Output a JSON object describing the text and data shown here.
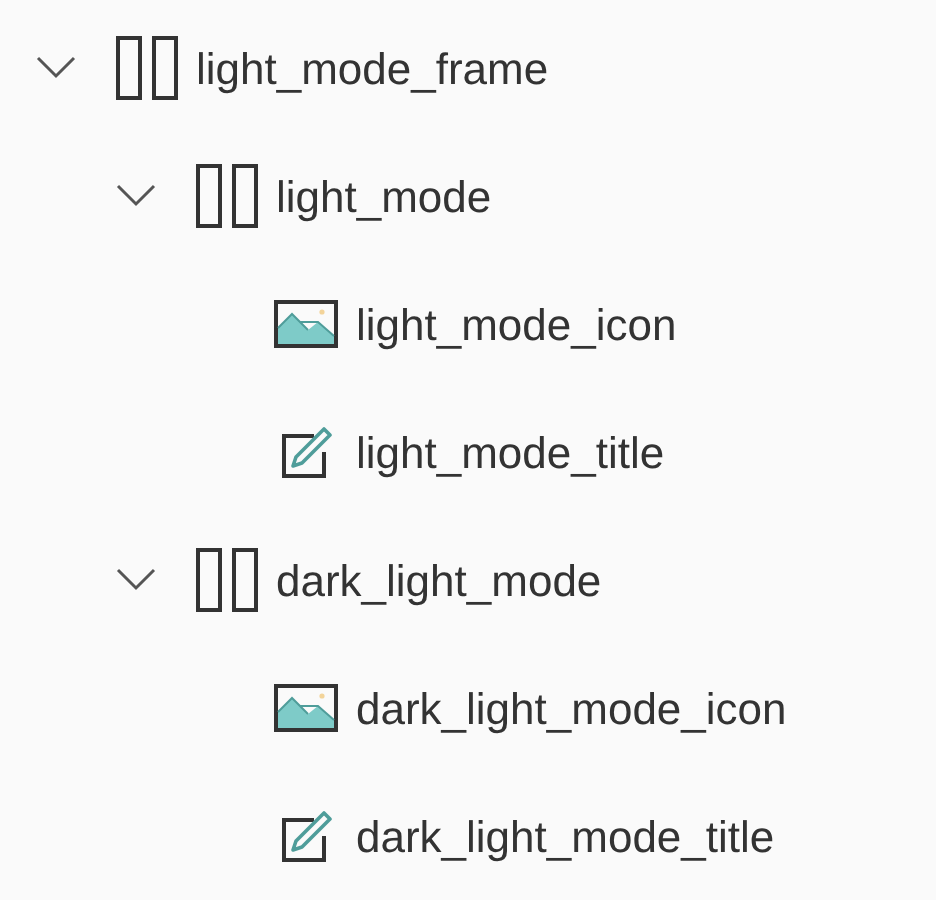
{
  "tree": [
    {
      "label": "light_mode_frame",
      "kind": "frame",
      "expanded": true,
      "children": [
        {
          "label": "light_mode",
          "kind": "frame",
          "expanded": true,
          "children": [
            {
              "label": "light_mode_icon",
              "kind": "image"
            },
            {
              "label": "light_mode_title",
              "kind": "text"
            }
          ]
        },
        {
          "label": "dark_light_mode",
          "kind": "frame",
          "expanded": true,
          "children": [
            {
              "label": "dark_light_mode_icon",
              "kind": "image"
            },
            {
              "label": "dark_light_mode_title",
              "kind": "text"
            }
          ]
        }
      ]
    }
  ]
}
